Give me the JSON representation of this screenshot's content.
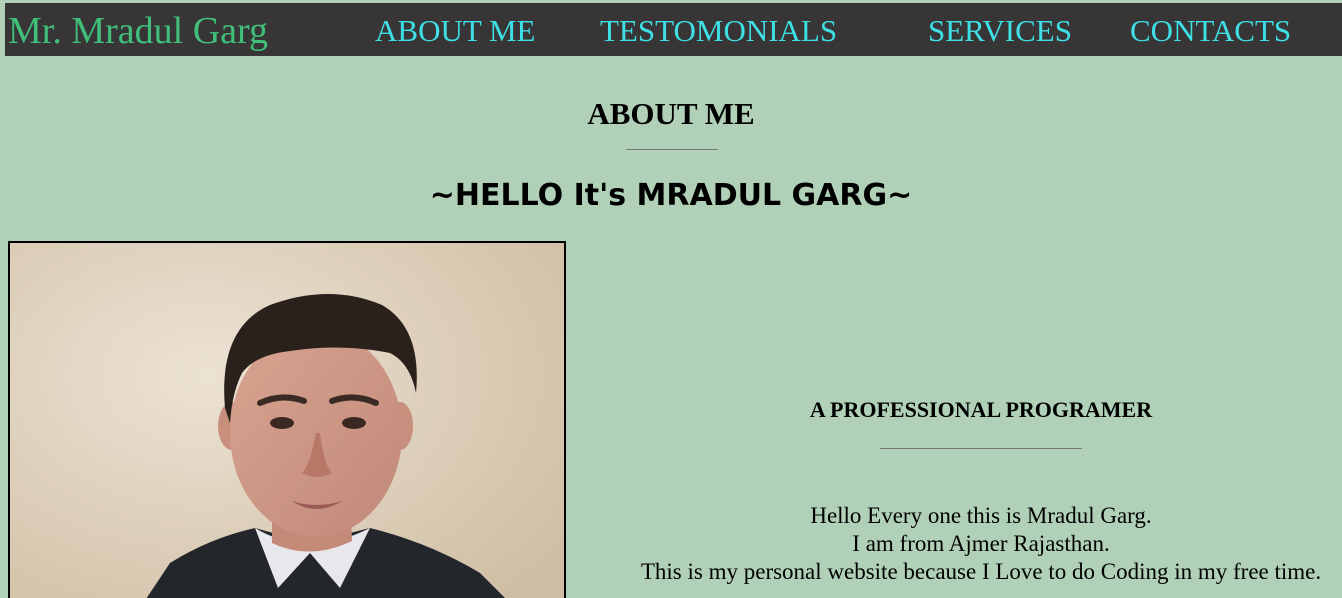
{
  "nav": {
    "brand": "Mr. Mradul Garg",
    "links": [
      "ABOUT ME",
      "TESTOMONIALS",
      "SERVICES",
      "CONTACTS"
    ]
  },
  "about": {
    "title": "ABOUT ME",
    "greeting": "~HELLO It's MRADUL GARG~",
    "subtitle": "A PROFESSIONAL PROGRAMER",
    "bio_lines": [
      "Hello Every one this is Mradul Garg.",
      "I am from Ajmer Rajasthan.",
      "This is my personal website because I Love to do Coding in my free time."
    ]
  },
  "colors": {
    "background": "#b0d0b7",
    "navbar": "#373535",
    "brand": "#3fbf7a",
    "nav_link": "#3ee0e6"
  }
}
